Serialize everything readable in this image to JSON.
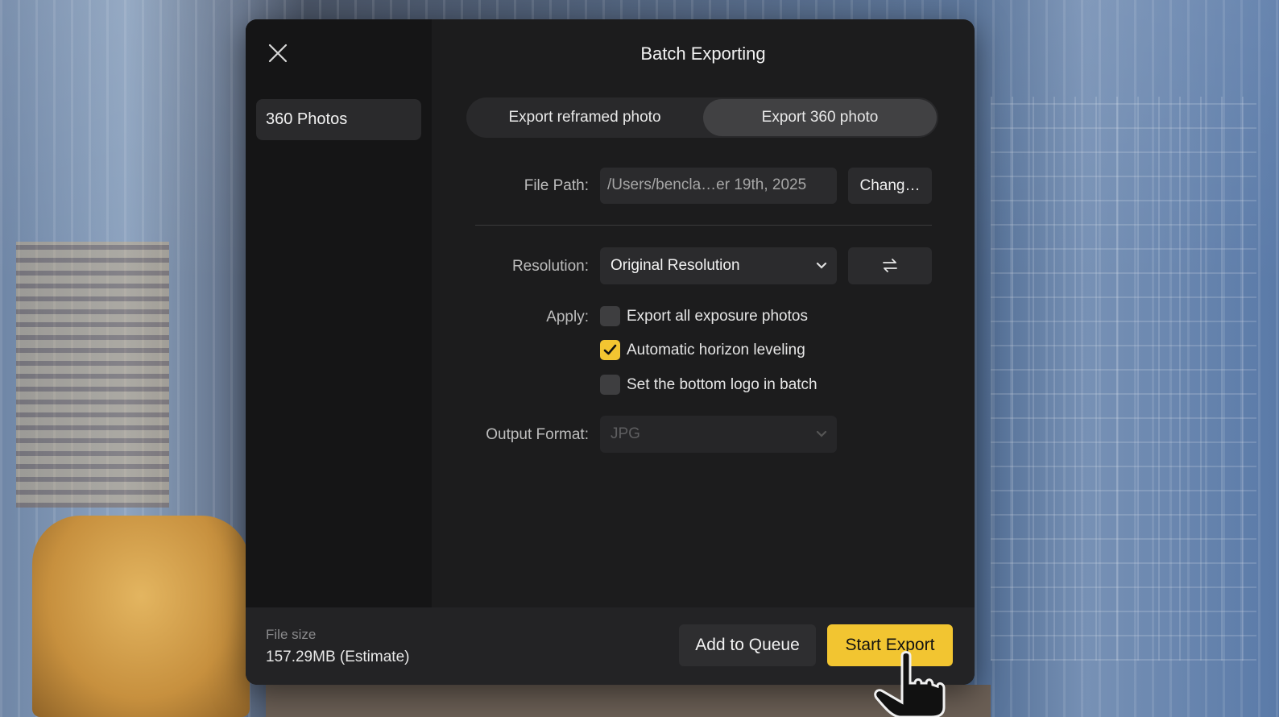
{
  "dialog": {
    "title": "Batch Exporting",
    "close_icon": "close-icon",
    "sidebar": {
      "items": [
        {
          "label": "360 Photos",
          "selected": true
        }
      ]
    },
    "export_mode": {
      "options": [
        "Export reframed photo",
        "Export 360 photo"
      ],
      "selected": "Export 360 photo"
    },
    "file_path": {
      "label": "File Path:",
      "value": "/Users/bencla…er 19th, 2025",
      "change_button": "Chang…"
    },
    "resolution": {
      "label": "Resolution:",
      "selected": "Original Resolution",
      "swap_icon": "swap-arrows-icon"
    },
    "apply": {
      "label": "Apply:",
      "options": [
        {
          "label": "Export all exposure photos",
          "checked": false
        },
        {
          "label": "Automatic horizon leveling",
          "checked": true
        },
        {
          "label": "Set the bottom logo in batch",
          "checked": false
        }
      ]
    },
    "output_format": {
      "label": "Output Format:",
      "selected": "JPG",
      "disabled": true
    },
    "footer": {
      "size_label": "File size",
      "size_value": "157.29MB (Estimate)",
      "add_to_queue": "Add to Queue",
      "start_export": "Start Export"
    }
  },
  "colors": {
    "accent": "#f2c531",
    "panel": "#1c1c1d",
    "sidebar": "#151516"
  }
}
